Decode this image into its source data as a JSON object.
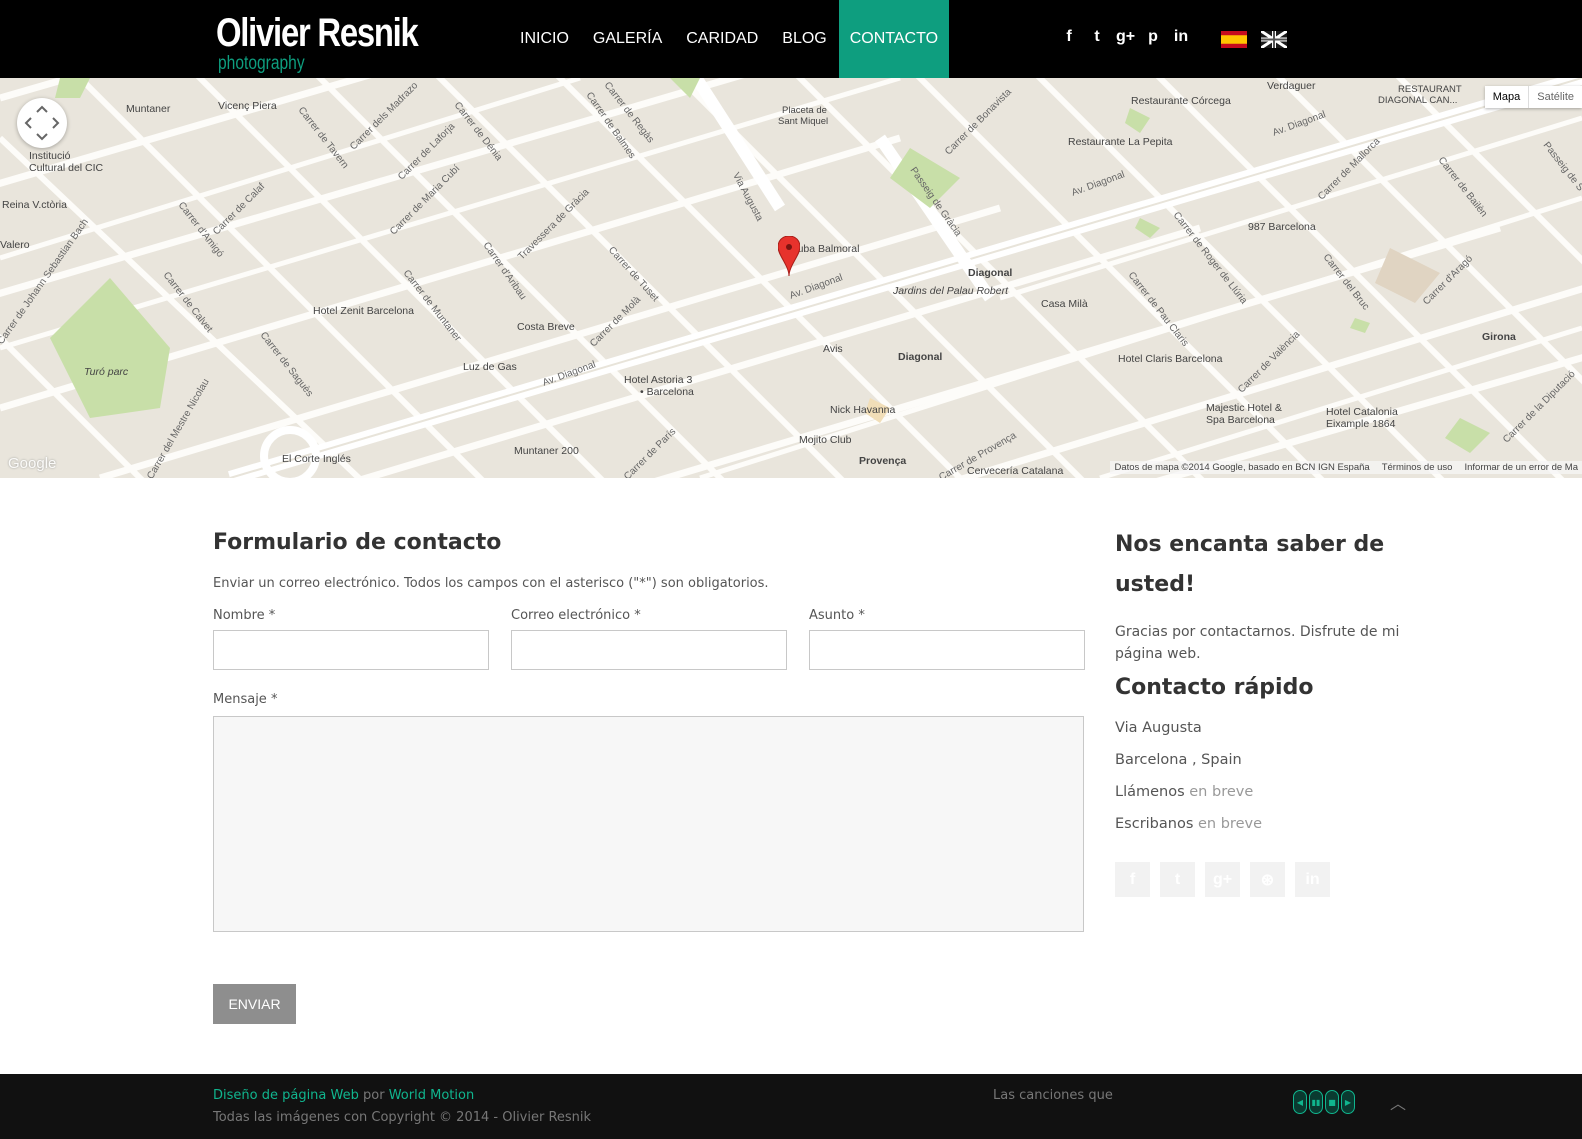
{
  "header": {
    "logo_title": "Olivier Resnik",
    "logo_subtitle": "photography",
    "nav": [
      {
        "label": "INICIO",
        "active": false
      },
      {
        "label": "GALERÍA",
        "active": false
      },
      {
        "label": "CARIDAD",
        "active": false
      },
      {
        "label": "BLOG",
        "active": false
      },
      {
        "label": "CONTACTO",
        "active": true
      }
    ],
    "social_icons": [
      {
        "icon": "facebook-icon",
        "glyph": "f"
      },
      {
        "icon": "twitter-icon",
        "glyph": "t"
      },
      {
        "icon": "google-plus-icon",
        "glyph": "g+"
      },
      {
        "icon": "pinterest-icon",
        "glyph": "p"
      },
      {
        "icon": "linkedin-icon",
        "glyph": "in"
      }
    ],
    "languages": [
      "es",
      "en"
    ],
    "accent_color": "#0e9e7f"
  },
  "map": {
    "type_buttons": {
      "active": "Mapa",
      "inactive": "Satélite"
    },
    "attribution": [
      "Datos de mapa ©2014 Google, basado en BCN IGN España",
      "Términos de uso",
      "Informar de un error de Ma"
    ],
    "google_logo": "Google",
    "labels": {
      "muntaner": "Muntaner",
      "vicenc_piera": "Vicenç Piera",
      "institucio": "Institució",
      "cultural": "Cultural del CIC",
      "reina": "Reina V.ctòria",
      "placeta": "Placeta de",
      "sant_miquel": "Sant Miquel",
      "verdaguer": "Verdaguer",
      "restaurant_dc": "RESTAURANT",
      "diagonal_can": "DIAGONAL CAN...",
      "corcega": "Restaurante Córcega",
      "pepita": "Restaurante La Pepita",
      "balmoral": "Cuba Balmoral",
      "diagonal_metro": "Diagonal",
      "jardins": "Jardins del Palau Robert",
      "casa_mila": "Casa Milà",
      "hotel_zenit": "Hotel Zenit Barcelona",
      "costa_breve": "Costa Breve",
      "luz_de_gas": "Luz de Gas",
      "turo_parc": "Turó parc",
      "avis": "Avis",
      "diagonal2": "Diagonal",
      "hotel_astoria": "Hotel Astoria 3",
      "astoria_bcn": "• Barcelona",
      "nick_havanna": "Nick Havanna",
      "mojito": "Mojito Club",
      "provenca": "Provença",
      "cerveceria": "Cervecería Catalana",
      "muntaner200": "Muntaner 200",
      "corte_ingles": "El Corte Inglés",
      "barcelona987": "987 Barcelona",
      "claris": "Hotel Claris Barcelona",
      "majestic": "Majestic Hotel &",
      "majestic2": "Spa Barcelona",
      "catalonia": "Hotel Catalonia",
      "eixample": "Eixample 1864",
      "girona": "Girona",
      "valero": "Valero"
    },
    "streets": {
      "av_diagonal_1": "Av. Diagonal",
      "av_diagonal_2": "Av. Diagonal",
      "av_diagonal_3": "Av. Diagonal",
      "av_diagonal_4": "Av. Diagonal",
      "via_augusta": "Via Augusta",
      "travessera": "Travessera de Gràcia",
      "balmes": "Carrer de Balmes",
      "tuset": "Carrer de Tuset",
      "aribau": "Carrer d'Aribau",
      "muntaner_st": "Carrer de Muntaner",
      "calvet": "Carrer de Calvet",
      "amigo": "Carrer d'Amigó",
      "laforja": "Carrer de Laforja",
      "maria_cubi": "Carrer de Maria Cubí",
      "madrazo": "Carrer dels Madrazo",
      "tavern": "Carrer de Tavern",
      "regas": "Carrer de Regàs",
      "denia": "Carrer de Dénia",
      "passeig_gracia": "Passeig de Gràcia",
      "bonavista": "Carrer de Bonavista",
      "mallorca": "Carrer de Mallorca",
      "roger": "Carrer de Roger de Llúria",
      "pau_claris": "Carrer de Pau Claris",
      "bruc": "Carrer del Bruc",
      "arago": "Carrer d'Aragó",
      "valencia": "Carrer de València",
      "bailen": "Carrer de Bailèn",
      "sebastian_bach": "Carrer de Johann Sebastian Bach",
      "nicolau": "Carrer del Mestre Nicolau",
      "sagues": "Carrer de Saguès",
      "mola": "Carrer de Molà",
      "calaf": "Carrer de Calaf",
      "paris": "Carrer de París",
      "provenca_st": "Carrer de Provença",
      "diputacio": "Carrer de la Diputació",
      "passeig_s": "Passeig de S"
    }
  },
  "form": {
    "title": "Formulario de contacto",
    "description": "Enviar un correo electrónico. Todos los campos con el asterisco (\"*\") son obligatorios.",
    "fields": {
      "name_label": "Nombre",
      "email_label": "Correo electrónico",
      "subject_label": "Asunto",
      "message_label": "Mensaje",
      "required_mark": "*"
    },
    "values": {
      "name": "",
      "email": "",
      "subject": "",
      "message": ""
    },
    "submit_label": "ENVIAR"
  },
  "sidebar": {
    "title": "Nos encanta saber de usted!",
    "title_line1": "Nos encanta saber de",
    "title_line2": "usted!",
    "text": "Gracias por contactarnos. Disfrute de mi página web.",
    "quick_title": "Contacto rápido",
    "address1": "Via Augusta",
    "address2": "Barcelona , Spain",
    "call_label": "Llámenos",
    "call_value": "en breve",
    "write_label": "Escribanos",
    "write_value": "en breve",
    "social_icons": [
      {
        "icon": "facebook-icon",
        "glyph": "f"
      },
      {
        "icon": "twitter-icon",
        "glyph": "t"
      },
      {
        "icon": "google-plus-icon",
        "glyph": "g+"
      },
      {
        "icon": "dribbble-icon",
        "glyph": "⊛"
      },
      {
        "icon": "linkedin-icon",
        "glyph": "in"
      }
    ]
  },
  "footer": {
    "design_link": "Diseño de página Web",
    "by": "por",
    "company_link": "World Motion",
    "copyright": "Todas las imágenes con Copyright © 2014 - Olivier Resnik",
    "songs": "Las canciones que",
    "player_glyphs": [
      "◀",
      "▮▮",
      "■",
      "▶"
    ],
    "to_top_glyph": "︿"
  }
}
